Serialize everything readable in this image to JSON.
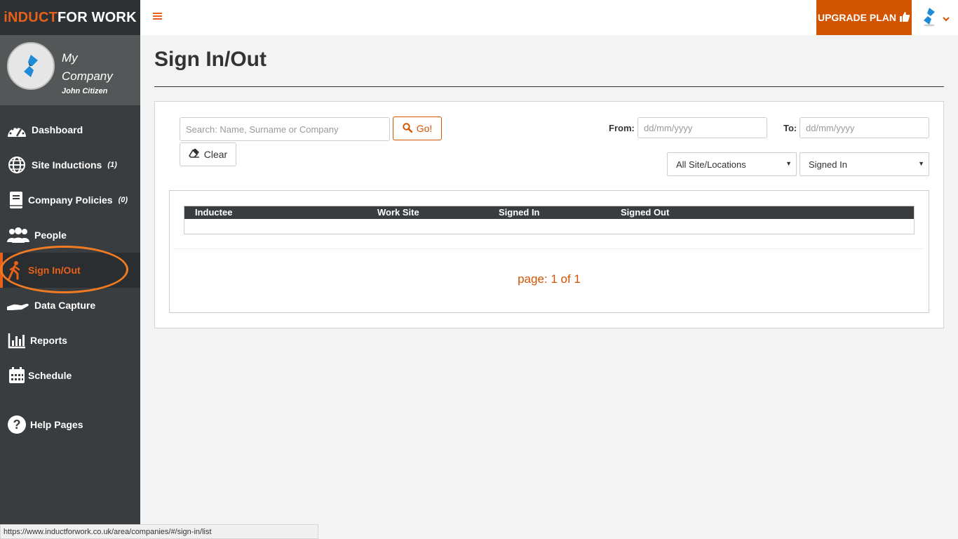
{
  "brand": {
    "part1": "iNDUCT",
    "part2": "FOR WORK"
  },
  "profile": {
    "company": "My Company",
    "user": "John Citizen"
  },
  "nav": [
    {
      "label": "Dashboard",
      "icon": "dashboard-gauge-icon",
      "count": ""
    },
    {
      "label": "Site Inductions",
      "icon": "globe-icon",
      "count": "(1)"
    },
    {
      "label": "Company Policies",
      "icon": "book-icon",
      "count": "(0)"
    },
    {
      "label": "People",
      "icon": "people-icon",
      "count": ""
    },
    {
      "label": "Sign In/Out",
      "icon": "walking-person-icon",
      "count": "",
      "active": true
    },
    {
      "label": "Data Capture",
      "icon": "hand-icon",
      "count": ""
    },
    {
      "label": "Reports",
      "icon": "bar-chart-icon",
      "count": ""
    },
    {
      "label": "Schedule",
      "icon": "calendar-icon",
      "count": ""
    },
    {
      "label": "Help Pages",
      "icon": "question-circle-icon",
      "count": ""
    }
  ],
  "topbar": {
    "upgrade_label": "UPGRADE PLAN"
  },
  "page": {
    "title": "Sign In/Out"
  },
  "filters": {
    "search_placeholder": "Search: Name, Surname or Company",
    "go_label": "Go!",
    "clear_label": "Clear",
    "from_label": "From:",
    "from_placeholder": "dd/mm/yyyy",
    "to_label": "To:",
    "to_placeholder": "dd/mm/yyyy",
    "site_selected": "All Site/Locations",
    "status_selected": "Signed In"
  },
  "table": {
    "columns": [
      "Inductee",
      "Work Site",
      "Signed In",
      "Signed Out"
    ],
    "rows": []
  },
  "pager": {
    "text": "page: 1 of 1"
  },
  "status_bar": {
    "url": "https://www.inductforwork.co.uk/area/companies/#/sign-in/list"
  },
  "colors": {
    "accent": "#d35400",
    "sidebar": "#3a3d3f",
    "highlight": "#f07b22"
  }
}
